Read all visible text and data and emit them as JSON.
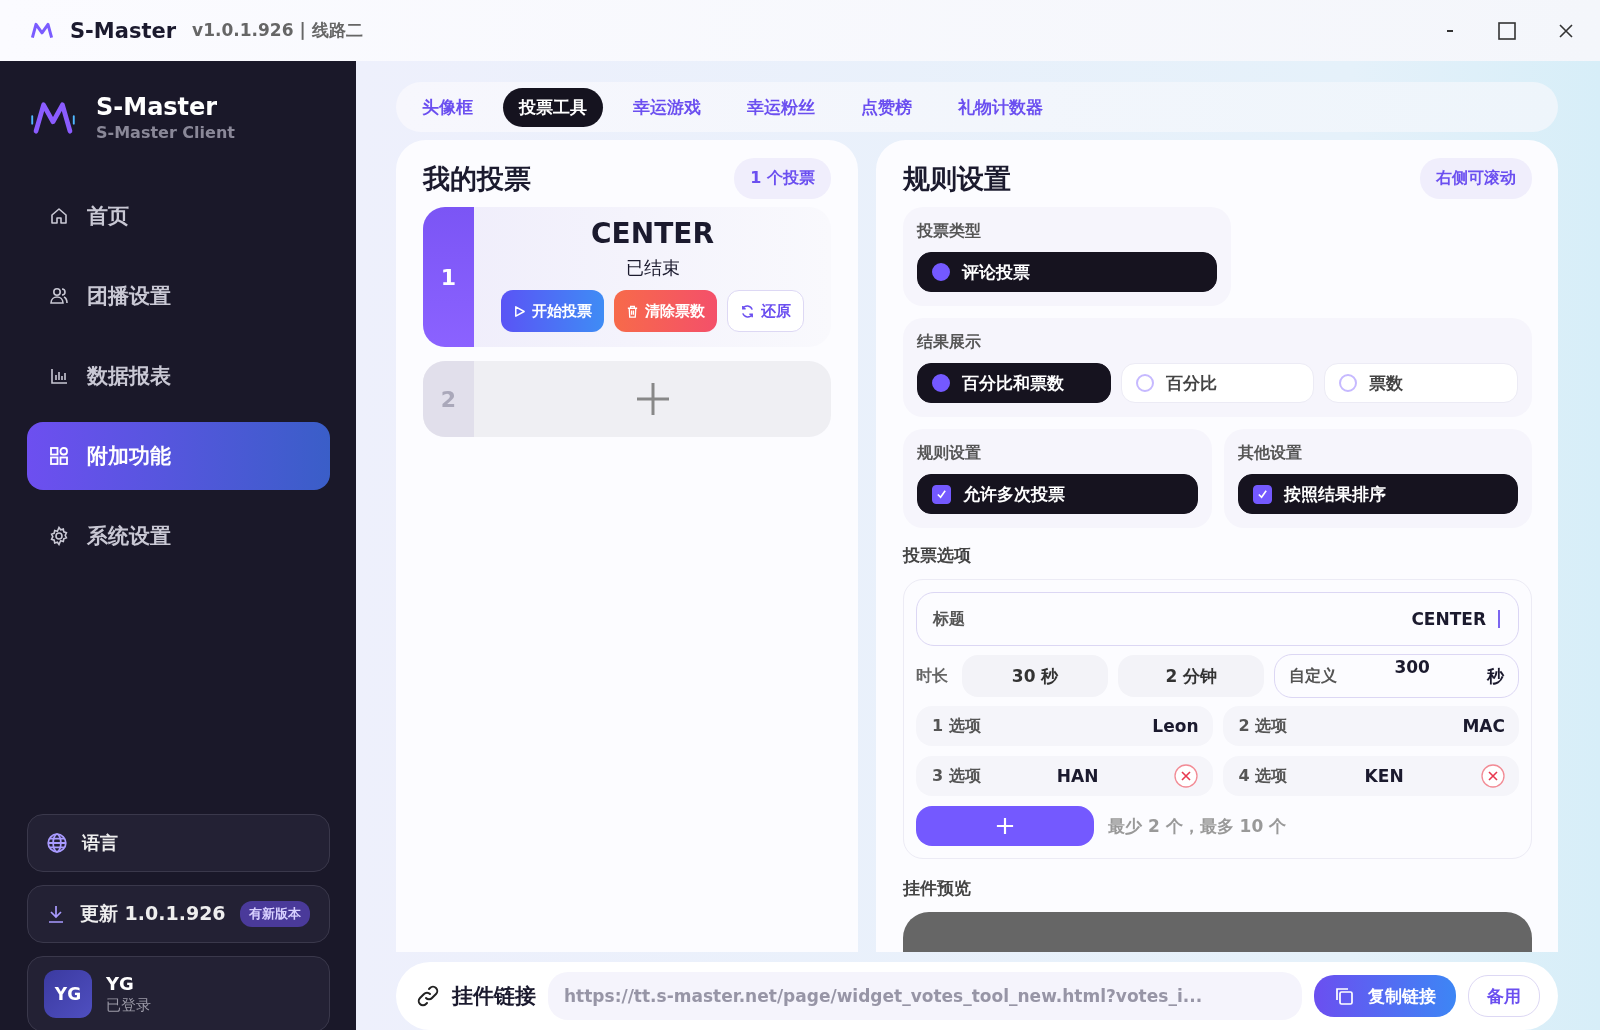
{
  "window": {
    "title": "S-Master",
    "version": "v1.0.1.926 | 线路二"
  },
  "sidebar": {
    "brand": "S-Master",
    "subtitle": "S-Master Client",
    "items": [
      {
        "label": "首页",
        "kind": "home",
        "selected": false
      },
      {
        "label": "团播设置",
        "kind": "users",
        "selected": false
      },
      {
        "label": "数据报表",
        "kind": "chart",
        "selected": false
      },
      {
        "label": "附加功能",
        "kind": "apps",
        "selected": true
      },
      {
        "label": "系统设置",
        "kind": "gear",
        "selected": false
      }
    ],
    "language": "语言",
    "update": {
      "label": "更新 1.0.1.926",
      "badge": "有新版本"
    },
    "user": {
      "avatar": "YG",
      "name": "YG",
      "status": "已登录"
    }
  },
  "tabs": [
    {
      "label": "头像框",
      "selected": false
    },
    {
      "label": "投票工具",
      "selected": true
    },
    {
      "label": "幸运游戏",
      "selected": false
    },
    {
      "label": "幸运粉丝",
      "selected": false
    },
    {
      "label": "点赞榜",
      "selected": false
    },
    {
      "label": "礼物计数器",
      "selected": false
    }
  ],
  "votes_panel": {
    "title": "我的投票",
    "count": "1 个投票",
    "votes": [
      {
        "kind": "vote",
        "number": "1",
        "title": "CENTER",
        "status": "已结束",
        "buttons": [
          {
            "kind": "start",
            "label": "开始投票"
          },
          {
            "kind": "clear",
            "label": "清除票数"
          },
          {
            "kind": "restore",
            "label": "还原"
          }
        ]
      },
      {
        "kind": "add",
        "number": "2"
      }
    ]
  },
  "rules_panel": {
    "title": "规则设置",
    "scroll_hint": "右侧可滚动",
    "vote_type": {
      "label": "投票类型",
      "options": [
        {
          "label": "评论投票",
          "selected": true
        }
      ]
    },
    "result_display": {
      "label": "结果展示",
      "options": [
        {
          "label": "百分比和票数",
          "selected": true
        },
        {
          "label": "百分比",
          "selected": false
        },
        {
          "label": "票数",
          "selected": false
        }
      ]
    },
    "rule_settings": {
      "label": "规则设置",
      "options": [
        {
          "label": "允许多次投票",
          "checked": true
        }
      ]
    },
    "other_settings": {
      "label": "其他设置",
      "options": [
        {
          "label": "按照结果排序",
          "checked": true
        }
      ]
    },
    "vote_options": {
      "label": "投票选项",
      "title_field": {
        "label": "标题",
        "value": "CENTER"
      },
      "duration": {
        "label": "时长",
        "presets": [
          "30 秒",
          "2 分钟"
        ],
        "custom_label": "自定义",
        "custom_value": "300",
        "unit": "秒"
      },
      "options": [
        {
          "label": "1 选项",
          "value": "Leon",
          "removable": false
        },
        {
          "label": "2 选项",
          "value": "MAC",
          "removable": false
        },
        {
          "label": "3 选项",
          "value": "HAN",
          "removable": true
        },
        {
          "label": "4 选项",
          "value": "KEN",
          "removable": true
        }
      ],
      "limit_hint": "最少 2 个，最多 10 个"
    },
    "preview_label": "挂件预览"
  },
  "widget_link": {
    "label": "挂件链接",
    "url": "https://tt.s-master.net/page/widget_votes_tool_new.html?votes_i...",
    "copy": "复制链接",
    "backup": "备用"
  }
}
